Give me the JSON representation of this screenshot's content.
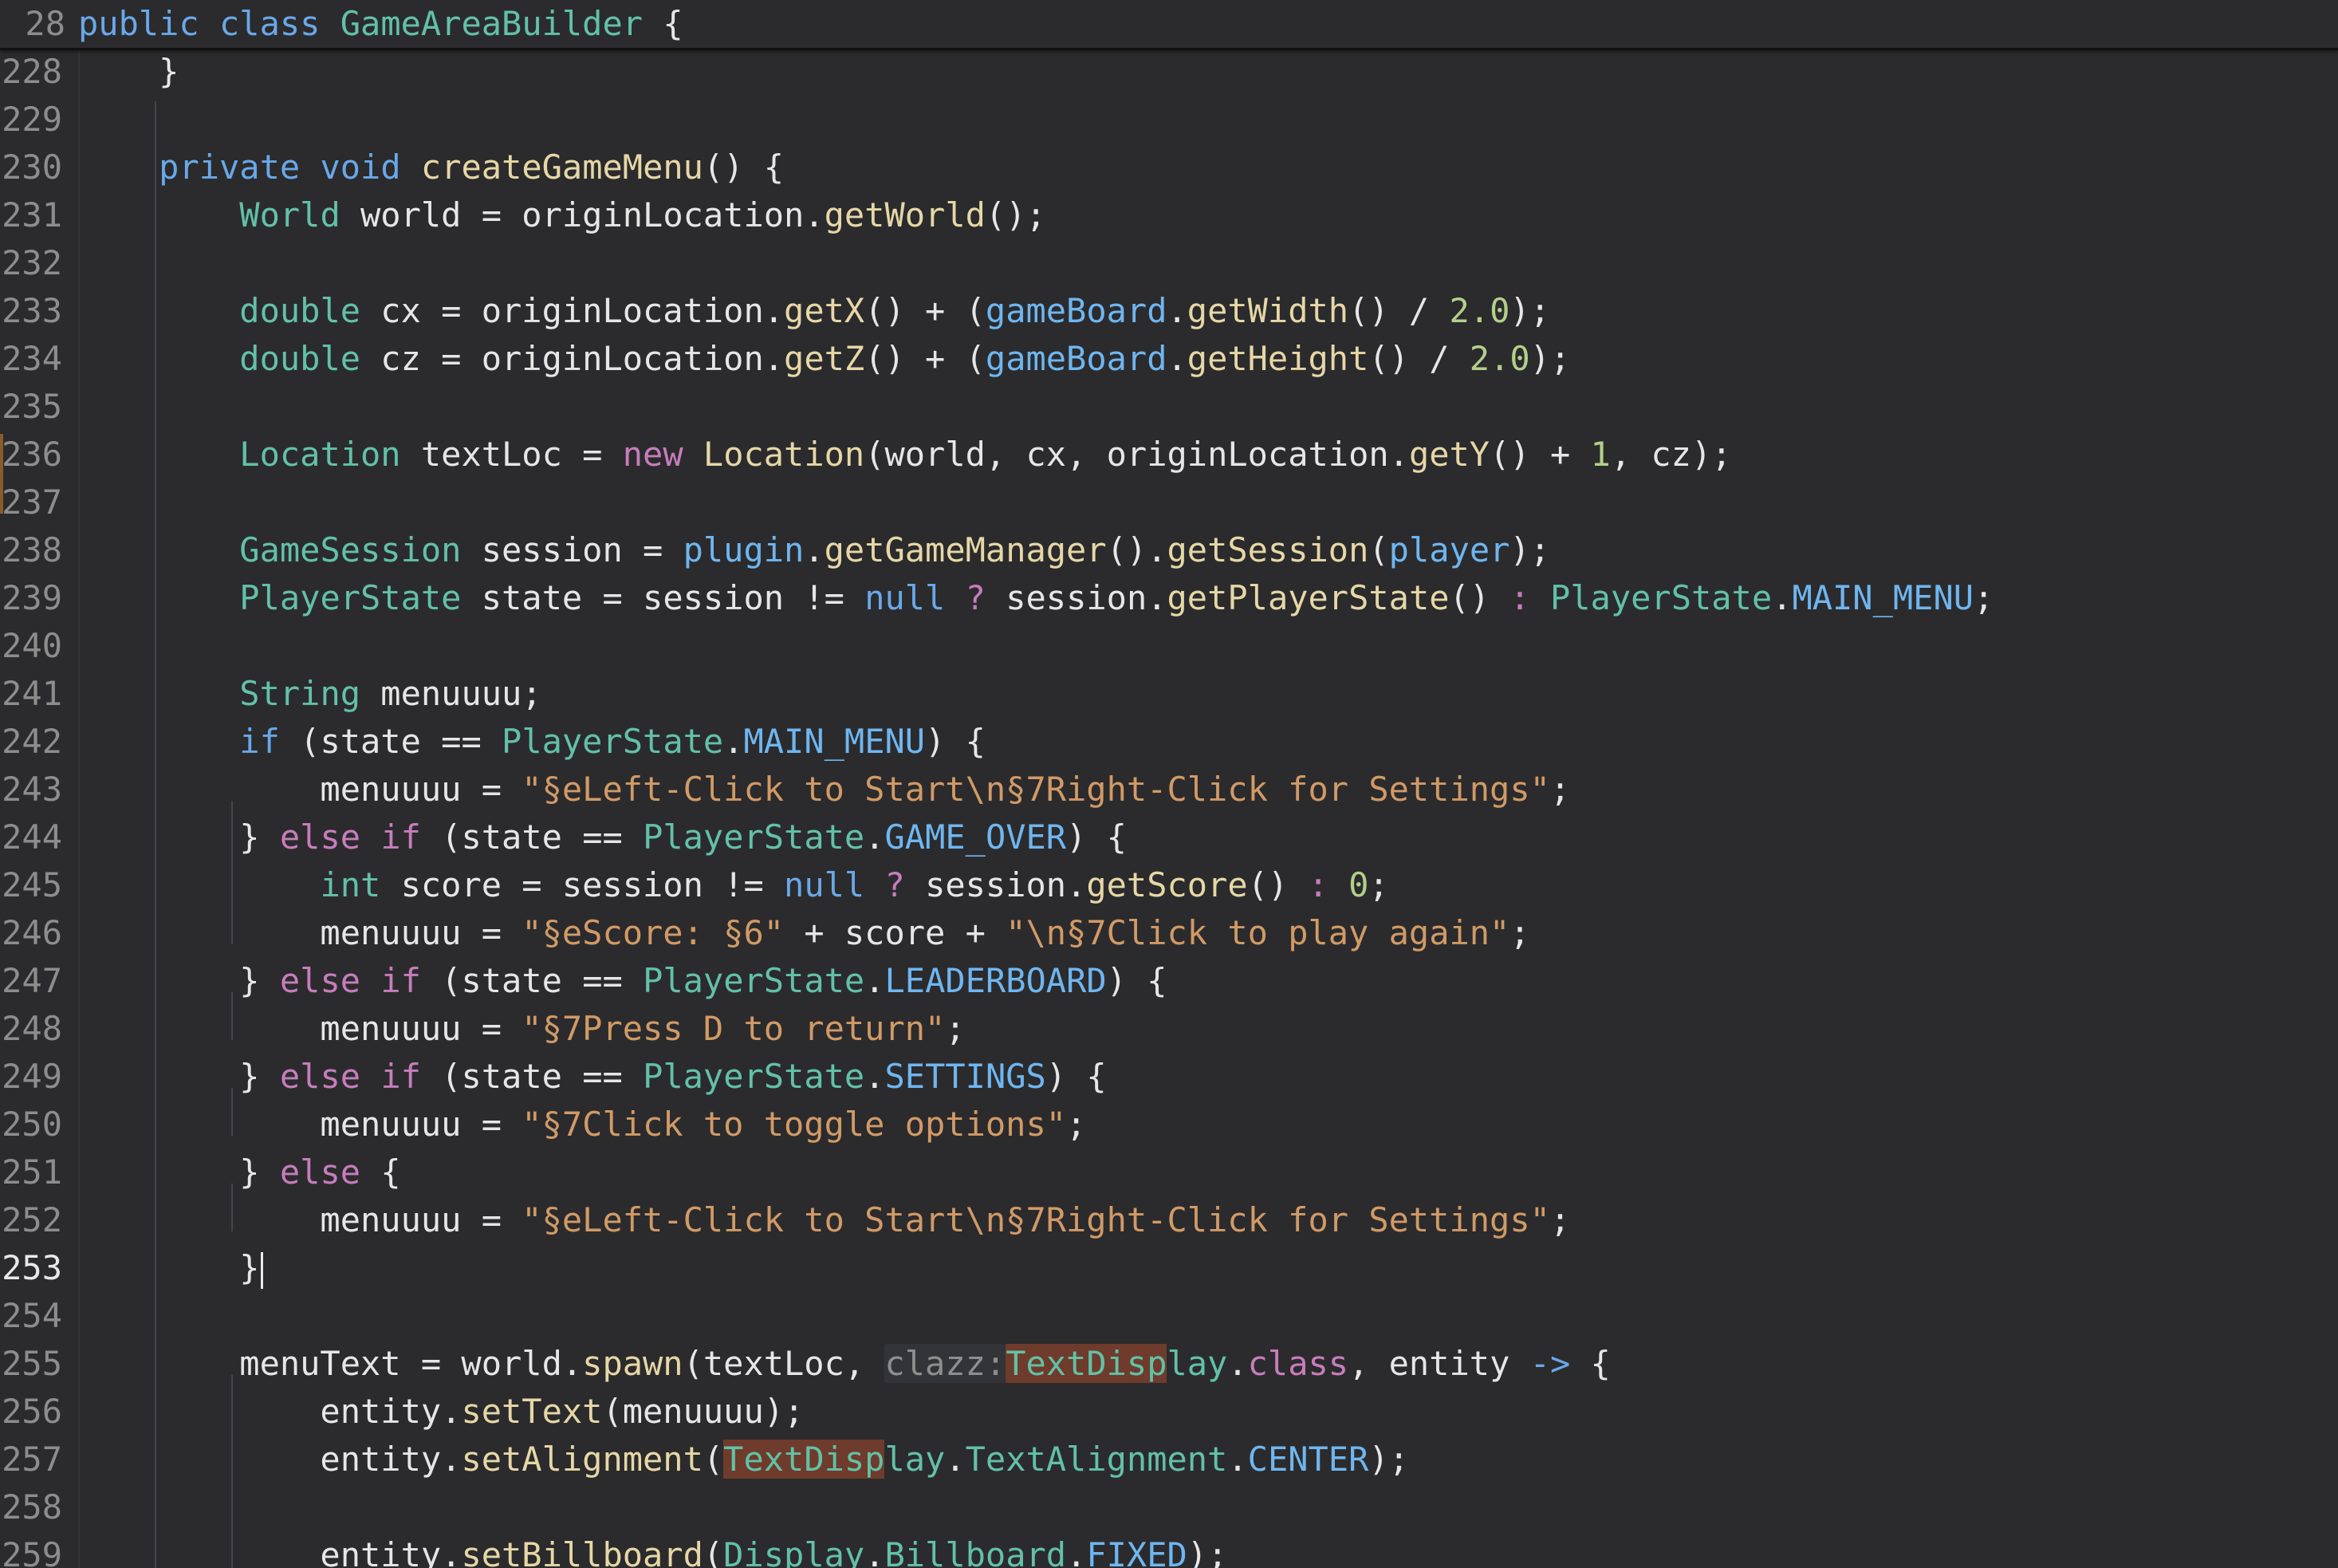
{
  "editor": {
    "sticky_header": {
      "line_number": "28",
      "code": "public class GameAreaBuilder {"
    },
    "lines": [
      {
        "num": "228",
        "text": "    }"
      },
      {
        "num": "229",
        "text": ""
      },
      {
        "num": "230",
        "text": "    private void createGameMenu() {"
      },
      {
        "num": "231",
        "text": "        World world = originLocation.getWorld();"
      },
      {
        "num": "232",
        "text": ""
      },
      {
        "num": "233",
        "text": "        double cx = originLocation.getX() + (gameBoard.getWidth() / 2.0);"
      },
      {
        "num": "234",
        "text": "        double cz = originLocation.getZ() + (gameBoard.getHeight() / 2.0);"
      },
      {
        "num": "235",
        "text": ""
      },
      {
        "num": "236",
        "text": "        Location textLoc = new Location(world, cx, originLocation.getY() + 1, cz);"
      },
      {
        "num": "237",
        "text": ""
      },
      {
        "num": "238",
        "text": "        GameSession session = plugin.getGameManager().getSession(player);"
      },
      {
        "num": "239",
        "text": "        PlayerState state = session != null ? session.getPlayerState() : PlayerState.MAIN_MENU;"
      },
      {
        "num": "240",
        "text": ""
      },
      {
        "num": "241",
        "text": "        String menuuuu;"
      },
      {
        "num": "242",
        "text": "        if (state == PlayerState.MAIN_MENU) {"
      },
      {
        "num": "243",
        "text": "            menuuuu = \"§eLeft-Click to Start\\n§7Right-Click for Settings\";"
      },
      {
        "num": "244",
        "text": "        } else if (state == PlayerState.GAME_OVER) {"
      },
      {
        "num": "245",
        "text": "            int score = session != null ? session.getScore() : 0;"
      },
      {
        "num": "246",
        "text": "            menuuuu = \"§eScore: §6\" + score + \"\\n§7Click to play again\";"
      },
      {
        "num": "247",
        "text": "        } else if (state == PlayerState.LEADERBOARD) {"
      },
      {
        "num": "248",
        "text": "            menuuuu = \"§7Press D to return\";"
      },
      {
        "num": "249",
        "text": "        } else if (state == PlayerState.SETTINGS) {"
      },
      {
        "num": "250",
        "text": "            menuuuu = \"§7Click to toggle options\";"
      },
      {
        "num": "251",
        "text": "        } else {"
      },
      {
        "num": "252",
        "text": "            menuuuu = \"§eLeft-Click to Start\\n§7Right-Click for Settings\";"
      },
      {
        "num": "253",
        "text": "        }"
      },
      {
        "num": "254",
        "text": ""
      },
      {
        "num": "255",
        "text": "        menuText = world.spawn(textLoc, clazz:TextDisplay.class, entity -> {"
      },
      {
        "num": "256",
        "text": "            entity.setText(menuuuu);"
      },
      {
        "num": "257",
        "text": "            entity.setAlignment(TextDisplay.TextAlignment.CENTER);"
      },
      {
        "num": "258",
        "text": ""
      },
      {
        "num": "259",
        "text": "            entity.setBillboard(Display.Billboard.FIXED);"
      }
    ],
    "current_line": "253",
    "param_hint": "clazz:"
  }
}
